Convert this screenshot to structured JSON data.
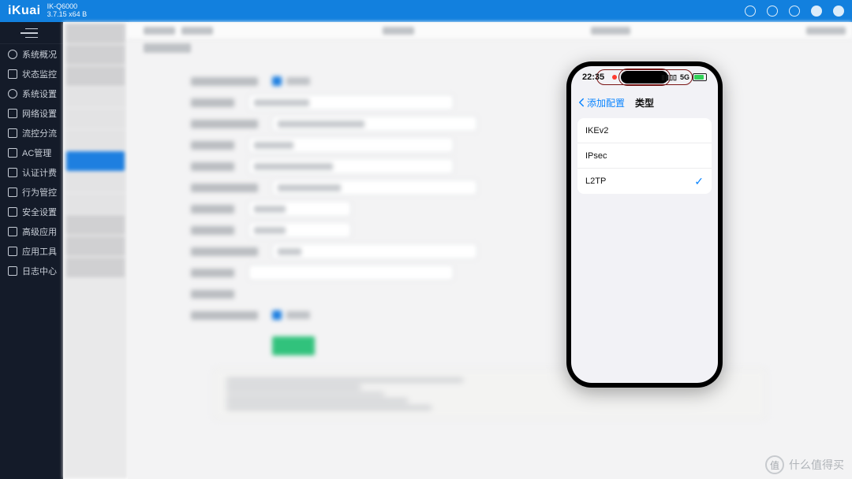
{
  "brand": "iKuai",
  "model_line1": "IK-Q6000",
  "model_line2": "3.7.15 x64 B",
  "sidebar": {
    "items": [
      {
        "label": "系统概况"
      },
      {
        "label": "状态监控"
      },
      {
        "label": "系统设置"
      },
      {
        "label": "网络设置"
      },
      {
        "label": "流控分流"
      },
      {
        "label": "AC管理"
      },
      {
        "label": "认证计费"
      },
      {
        "label": "行为管控"
      },
      {
        "label": "安全设置"
      },
      {
        "label": "高级应用"
      },
      {
        "label": "应用工具"
      },
      {
        "label": "日志中心"
      }
    ]
  },
  "phone": {
    "time": "22:35",
    "signal": "5G",
    "back_label": "添加配置",
    "title": "类型",
    "options": [
      {
        "label": "IKEv2",
        "selected": false
      },
      {
        "label": "IPsec",
        "selected": false
      },
      {
        "label": "L2TP",
        "selected": true
      }
    ]
  },
  "watermark": {
    "badge": "值",
    "text": "什么值得买"
  }
}
